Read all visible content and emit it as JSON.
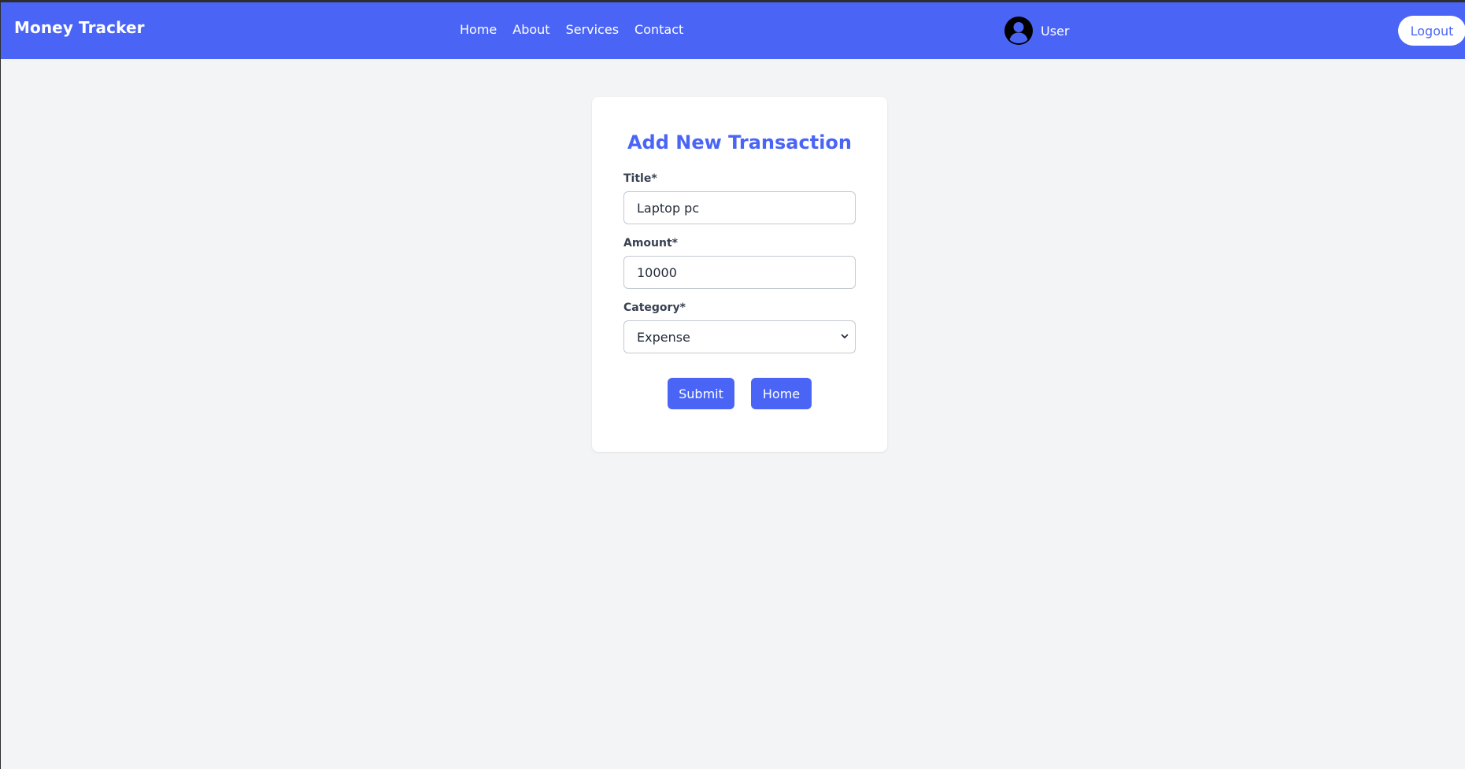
{
  "app": {
    "brand": "Money Tracker"
  },
  "nav": {
    "links": [
      "Home",
      "About",
      "Services",
      "Contact"
    ]
  },
  "user": {
    "name": "User",
    "avatar_icon": "user-circle-icon"
  },
  "header": {
    "logout_label": "Logout"
  },
  "form": {
    "title": "Add New Transaction",
    "title_label": "Title*",
    "title_value": "Laptop pc",
    "amount_label": "Amount*",
    "amount_value": "10000",
    "category_label": "Category*",
    "category_selected": "Expense",
    "submit_label": "Submit",
    "home_label": "Home"
  },
  "colors": {
    "primary": "#4a65f6",
    "background": "#f3f4f6",
    "card": "#ffffff"
  }
}
